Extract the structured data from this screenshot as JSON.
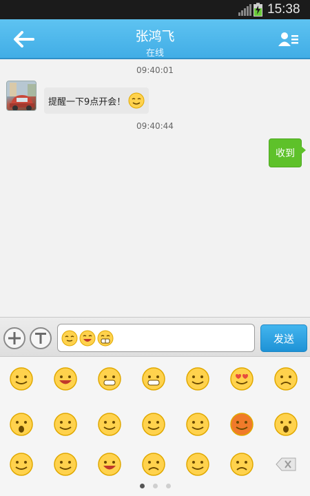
{
  "status_bar": {
    "time": "15:38"
  },
  "header": {
    "title": "张鸿飞",
    "subtitle": "在线"
  },
  "messages": [
    {
      "timestamp": "09:40:01",
      "side": "left",
      "text": "提醒一下9点开会！",
      "emoji": "smile-emoji"
    },
    {
      "timestamp": "09:40:44",
      "side": "right",
      "text": "收到"
    }
  ],
  "input": {
    "draft_emojis": [
      "smirk-emoji",
      "laugh-emoji",
      "grin-emoji"
    ],
    "send_label": "发送"
  },
  "emoji_panel": {
    "rows": [
      [
        "smile-emoji",
        "laugh-emoji",
        "grin-emoji",
        "cheeky-emoji",
        "shy-smile-emoji",
        "heart-eyes-emoji",
        "crying-emoji"
      ],
      [
        "surprised-emoji",
        "confused-emoji",
        "thumbs-up-emoji",
        "fist-emoji",
        "wink-tongue-emoji",
        "angry-emoji",
        "shocked-emoji"
      ],
      [
        "sick-emoji",
        "bandaged-emoji",
        "joyful-emoji",
        "sad-emoji",
        "annoyed-emoji",
        "doubtful-emoji",
        "backspace-key"
      ]
    ],
    "pages": 3,
    "current_page": 1
  },
  "colors": {
    "header": "#41ade6",
    "send_button": "#1e92d6",
    "my_bubble": "#5ec12a"
  }
}
